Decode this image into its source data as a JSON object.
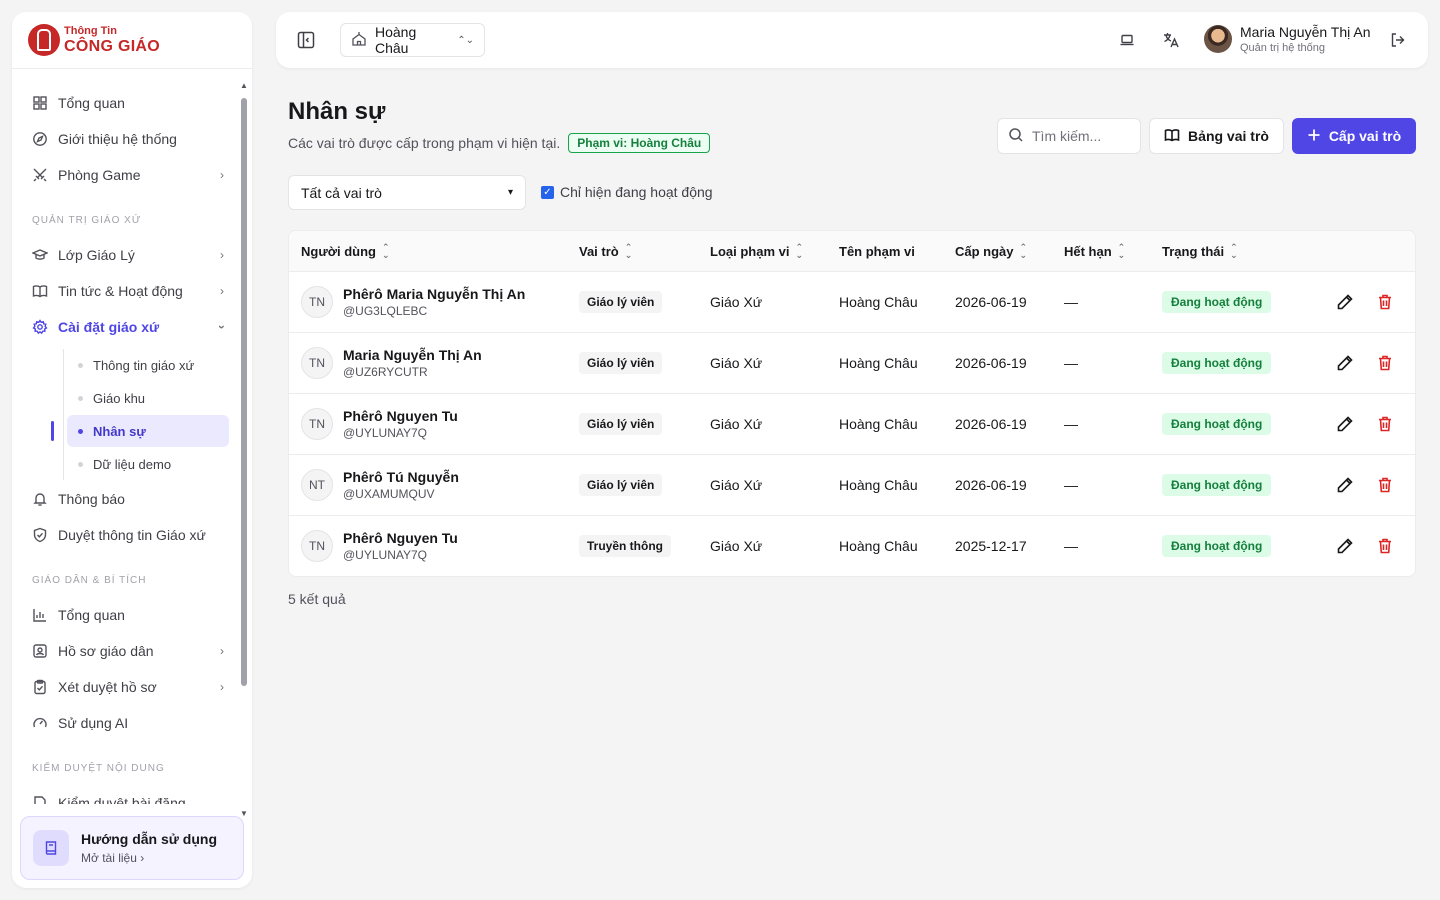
{
  "brand": {
    "top": "Thông Tin",
    "bottom": "CÔNG GIÁO"
  },
  "nav": {
    "top_items": [
      {
        "label": "Tổng quan",
        "icon": "grid-icon"
      },
      {
        "label": "Giới thiệu hệ thống",
        "icon": "compass-icon"
      },
      {
        "label": "Phòng Game",
        "icon": "swords-icon"
      }
    ],
    "section1": "QUẢN TRỊ GIÁO XỨ",
    "section1_items": [
      {
        "label": "Lớp Giáo Lý",
        "icon": "graduation-cap-icon"
      },
      {
        "label": "Tin tức & Hoạt động",
        "icon": "book-open-icon"
      },
      {
        "label": "Cài đặt giáo xứ",
        "icon": "gear-icon"
      }
    ],
    "sub_items": [
      "Thông tin giáo xứ",
      "Giáo khu",
      "Nhân sự",
      "Dữ liệu demo"
    ],
    "after_items": [
      {
        "label": "Thông báo",
        "icon": "bell-icon"
      },
      {
        "label": "Duyệt thông tin Giáo xứ",
        "icon": "shield-check-icon"
      }
    ],
    "section2": "GIÁO DÂN & BÍ TÍCH",
    "section2_items": [
      {
        "label": "Tổng quan",
        "icon": "bar-chart-icon"
      },
      {
        "label": "Hồ sơ giáo dân",
        "icon": "id-card-icon"
      },
      {
        "label": "Xét duyệt hồ sơ",
        "icon": "clipboard-check-icon"
      },
      {
        "label": "Sử dụng AI",
        "icon": "gauge-icon"
      }
    ],
    "section3": "KIỂM DUYỆT NỘI DUNG",
    "section3_items": [
      {
        "label": "Kiểm duyệt bài đăng",
        "icon": "file-check-icon"
      }
    ]
  },
  "guide": {
    "title": "Hướng dẫn sử dụng",
    "link": "Mở tài liệu"
  },
  "header": {
    "scope": "Hoàng Châu",
    "user_name": "Maria Nguyễn Thị An",
    "user_role": "Quản trị hệ thống"
  },
  "page": {
    "title": "Nhân sự",
    "subtitle": "Các vai trò được cấp trong phạm vi hiện tại.",
    "scope_badge": "Phạm vi: Hoàng Châu",
    "search_placeholder": "Tìm kiếm...",
    "roles_table_button": "Bảng vai trò",
    "grant_role_button": "Cấp vai trò",
    "filter_value": "Tất cả vai trò",
    "active_only_label": "Chỉ hiện đang hoạt động",
    "result_count": "5 kết quả"
  },
  "table": {
    "columns": [
      "Người dùng",
      "Vai trò",
      "Loại phạm vi",
      "Tên phạm vi",
      "Cấp ngày",
      "Hết hạn",
      "Trạng thái"
    ],
    "rows": [
      {
        "initials": "TN",
        "name": "Phêrô Maria Nguyễn Thị An",
        "handle": "@UG3LQLEBC",
        "role": "Giáo lý viên",
        "scope_type": "Giáo Xứ",
        "scope_name": "Hoàng Châu",
        "granted": "2026-06-19",
        "expires": "—",
        "status": "Đang hoạt động"
      },
      {
        "initials": "TN",
        "name": "Maria Nguyễn Thị An",
        "handle": "@UZ6RYCUTR",
        "role": "Giáo lý viên",
        "scope_type": "Giáo Xứ",
        "scope_name": "Hoàng Châu",
        "granted": "2026-06-19",
        "expires": "—",
        "status": "Đang hoạt động"
      },
      {
        "initials": "TN",
        "name": "Phêrô Nguyen Tu",
        "handle": "@UYLUNAY7Q",
        "role": "Giáo lý viên",
        "scope_type": "Giáo Xứ",
        "scope_name": "Hoàng Châu",
        "granted": "2026-06-19",
        "expires": "—",
        "status": "Đang hoạt động"
      },
      {
        "initials": "NT",
        "name": "Phêrô Tú Nguyễn",
        "handle": "@UXAMUMQUV",
        "role": "Giáo lý viên",
        "scope_type": "Giáo Xứ",
        "scope_name": "Hoàng Châu",
        "granted": "2026-06-19",
        "expires": "—",
        "status": "Đang hoạt động"
      },
      {
        "initials": "TN",
        "name": "Phêrô Nguyen Tu",
        "handle": "@UYLUNAY7Q",
        "role": "Truyền thông",
        "scope_type": "Giáo Xứ",
        "scope_name": "Hoàng Châu",
        "granted": "2025-12-17",
        "expires": "—",
        "status": "Đang hoạt động"
      }
    ]
  },
  "colors": {
    "accent": "#4f46e5",
    "brand": "#c62828",
    "status_green": "#15803d",
    "delete_red": "#dc2626"
  }
}
